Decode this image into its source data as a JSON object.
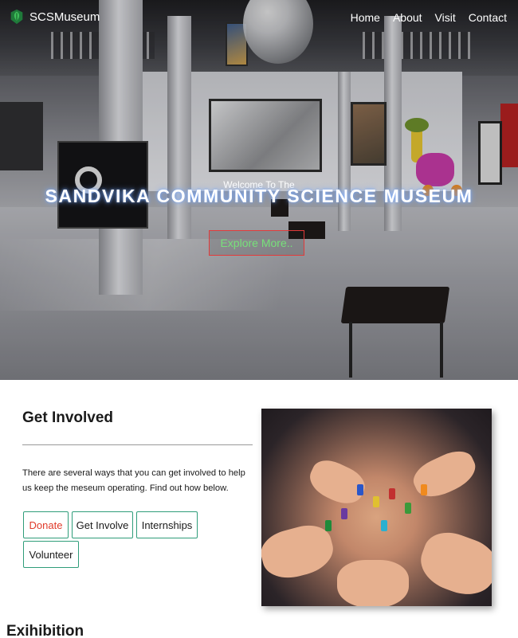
{
  "nav": {
    "brand": "SCSMuseum",
    "links": [
      "Home",
      "About",
      "Visit",
      "Contact"
    ]
  },
  "hero": {
    "welcome": "Welcome To The",
    "title": "SANDVIKA COMMUNITY SCIENCE MUSEUM",
    "cta": "Explore More.."
  },
  "get_involved": {
    "title": "Get Involved",
    "text": "There are several ways that you can get involved to help us keep the meseum operating. Find out how below.",
    "buttons": [
      "Donate",
      "Get Involve",
      "Internships",
      "Volunteer"
    ]
  },
  "exhibition": {
    "title": "Exihibition"
  },
  "colors": {
    "accent_green": "#2f9d7a",
    "donate_red": "#e03a2a",
    "cta_text": "#77e07a",
    "cta_border": "#e23a3a"
  }
}
